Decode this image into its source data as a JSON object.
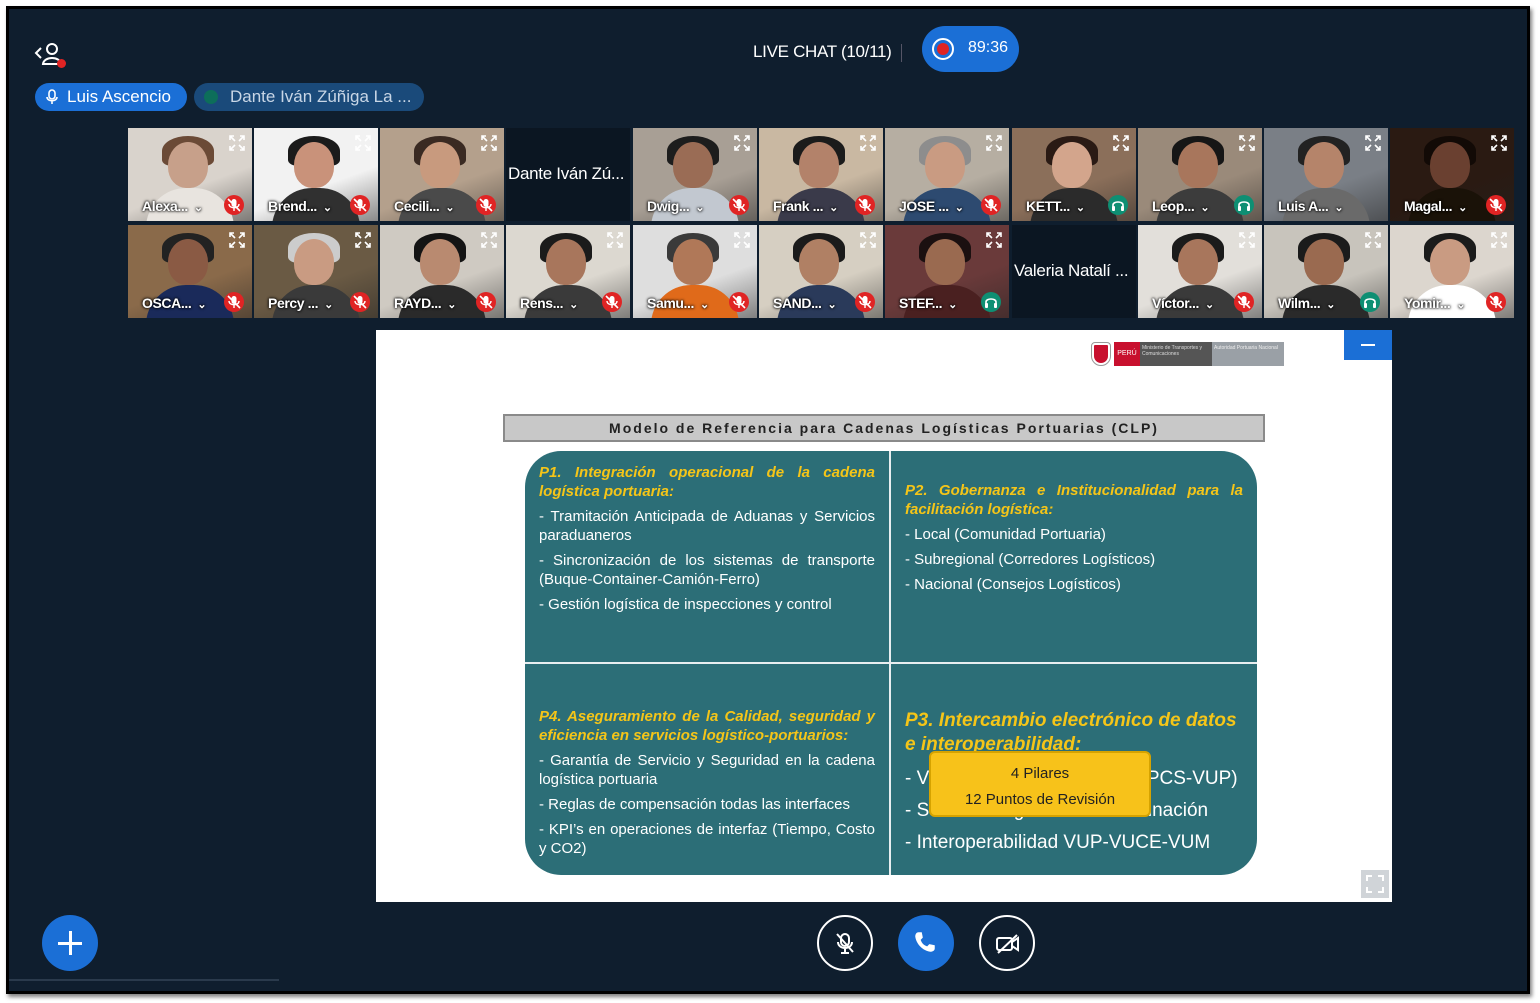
{
  "header": {
    "chat_title": "LIVE CHAT (10/11)",
    "recording_time": "89:36"
  },
  "talking": {
    "active_speaker": "Luis Ascencio",
    "other_speaker": "Dante Iván Zúñiga La ..."
  },
  "participants_row1": [
    {
      "name": "Alexa...",
      "status": "muted"
    },
    {
      "name": "Brend...",
      "status": "muted"
    },
    {
      "name": "Cecili...",
      "status": "muted"
    },
    {
      "name": "Dante Iván Zú...",
      "status": "none"
    },
    {
      "name": "Dwig...",
      "status": "muted"
    },
    {
      "name": "Frank ...",
      "status": "muted"
    },
    {
      "name": "JOSE ...",
      "status": "muted"
    },
    {
      "name": "KETT...",
      "status": "listen"
    },
    {
      "name": "Leop...",
      "status": "listen"
    },
    {
      "name": "Luis A...",
      "status": "none"
    },
    {
      "name": "Magal...",
      "status": "muted"
    }
  ],
  "participants_row2": [
    {
      "name": "OSCA...",
      "status": "muted"
    },
    {
      "name": "Percy ...",
      "status": "muted"
    },
    {
      "name": "RAYD...",
      "status": "muted"
    },
    {
      "name": "Rens...",
      "status": "muted"
    },
    {
      "name": "Samu...",
      "status": "muted"
    },
    {
      "name": "SAND...",
      "status": "muted"
    },
    {
      "name": "STEF...",
      "status": "listen"
    },
    {
      "name": "Valeria Natalí ...",
      "status": "none"
    },
    {
      "name": "Víctor...",
      "status": "muted"
    },
    {
      "name": "Wilm...",
      "status": "listen"
    },
    {
      "name": "Yomir...",
      "status": "muted"
    }
  ],
  "slide": {
    "logo_peru": "PERÚ",
    "logo_ministry": "Ministerio de Transportes y Comunicaciones",
    "logo_authority": "Autoridad Portuaria Nacional",
    "title": "Modelo de Referencia para Cadenas Logísticas Portuarias (CLP)",
    "p1_title": "P1. Integración operacional de la cadena logística portuaria:",
    "p1_items": [
      "- Tramitación Anticipada de Aduanas y Servicios paraduaneros",
      "- Sincronización de los sistemas de transporte (Buque-Container-Camión-Ferro)",
      "- Gestión logística de inspecciones y control"
    ],
    "p2_title": "P2. Gobernanza e Institucionalidad para la facilitación logística:",
    "p2_items": [
      "- Local (Comunidad Portuaria)",
      "- Subregional (Corredores Logísticos)",
      "- Nacional (Consejos Logísticos)"
    ],
    "p4_title": "P4. Aseguramiento de la Calidad, seguridad y eficiencia en servicios logístico-portuarios:",
    "p4_items": [
      "- Garantía de Servicio y Seguridad en la cadena logística portuaria",
      "- Reglas de compensación todas las interfaces",
      "- KPI’s en operaciones de interfaz (Tiempo, Costo y CO2)"
    ],
    "p3_title": "P3. Intercambio electrónico de datos e interoperabilidad:",
    "p3_items": [
      "- Ventanilla Unica Portuaria (PCS-VUP)",
      "- Servicios digitales de coordinación",
      "- Interoperabilidad VUP-VUCE-VUM"
    ],
    "center_line1": "4 Pilares",
    "center_line2": "12 Puntos de Revisión"
  },
  "colors": {
    "background": "#0f1e2e",
    "accent": "#1b6fd6",
    "muted": "#e02424",
    "listen": "#0e8f73",
    "diagram": "#2c6e77",
    "highlight": "#f5c518"
  }
}
